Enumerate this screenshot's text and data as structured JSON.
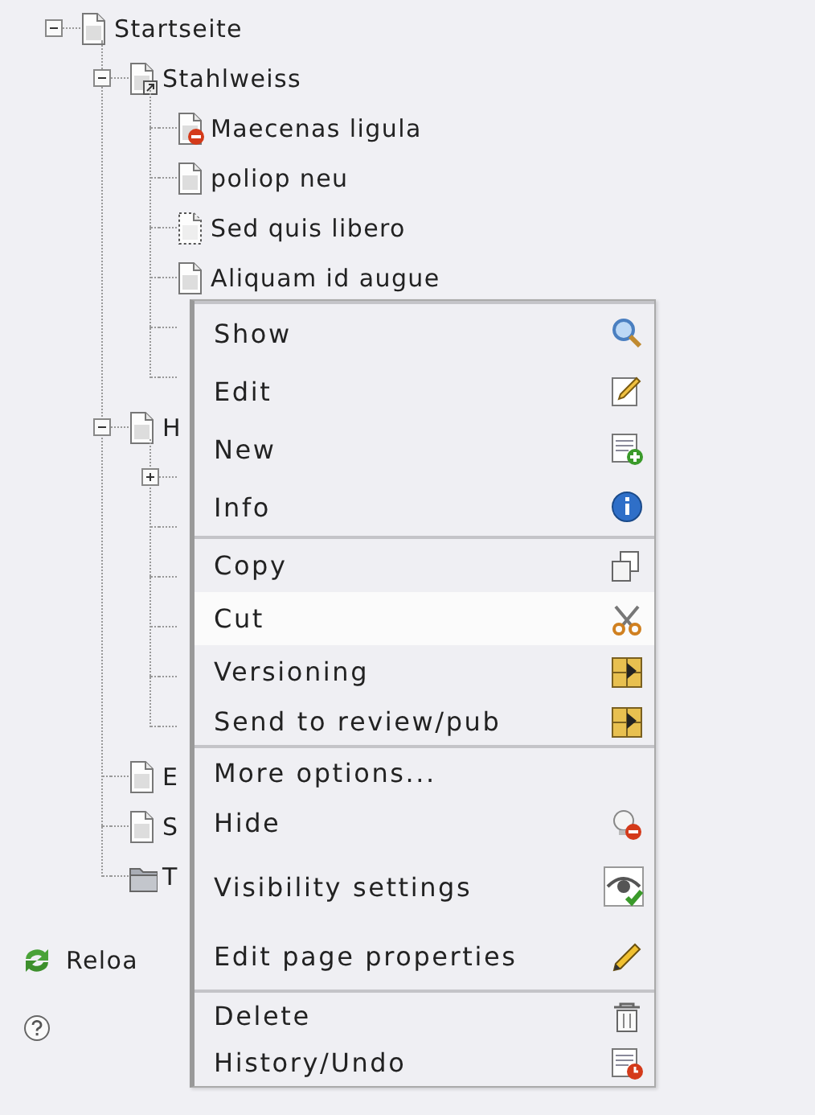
{
  "tree": [
    {
      "label": "Startseite",
      "kind": "page",
      "expanded": true,
      "children": [
        {
          "label": "Stahlweiss",
          "kind": "shortcut",
          "expanded": true,
          "children": [
            {
              "label": "Maecenas ligula",
              "kind": "hidden"
            },
            {
              "label": "poliop neu",
              "kind": "page"
            },
            {
              "label": "Sed quis libero",
              "kind": "draft"
            },
            {
              "label": "Aliquam id augue",
              "kind": "page"
            }
          ]
        },
        {
          "label": "H",
          "kind": "page",
          "expanded": true,
          "children": [
            {
              "expanded": false
            }
          ]
        },
        {
          "label": "E",
          "kind": "page"
        },
        {
          "label": "S",
          "kind": "page"
        },
        {
          "label": "T",
          "kind": "folder"
        }
      ]
    }
  ],
  "reload": {
    "label": "Reloa"
  },
  "context_menu": {
    "groups": [
      {
        "items": [
          {
            "label": "Show",
            "selected": false
          },
          {
            "label": "Edit",
            "selected": false
          },
          {
            "label": "New",
            "selected": false
          },
          {
            "label": "Info",
            "selected": false
          }
        ]
      },
      {
        "items": [
          {
            "label": "Copy",
            "selected": false
          },
          {
            "label": "Cut",
            "selected": true
          },
          {
            "label": "Versioning",
            "selected": false
          },
          {
            "label": "Send to review/pub",
            "selected": false
          }
        ]
      },
      {
        "items": [
          {
            "label": "More options...",
            "selected": false
          },
          {
            "label": "Hide",
            "selected": false
          },
          {
            "label": "Visibility settings",
            "selected": false
          },
          {
            "label": "Edit page properties",
            "selected": false
          }
        ]
      },
      {
        "items": [
          {
            "label": "Delete",
            "selected": false
          },
          {
            "label": "History/Undo",
            "selected": false
          }
        ]
      }
    ]
  }
}
